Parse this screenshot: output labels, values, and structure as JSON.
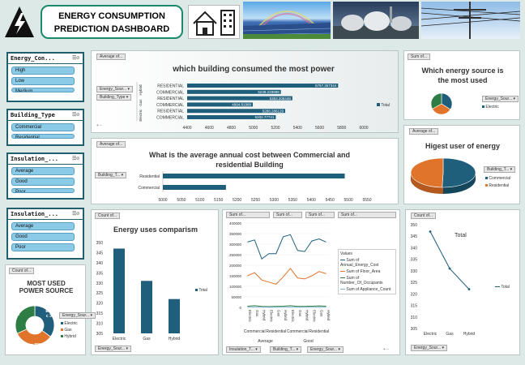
{
  "header": {
    "title_line1": "ENERGY CONSUMPTION",
    "title_line2": "PREDICTION DASHBOARD"
  },
  "slicers": [
    {
      "title": "Energy_Con...",
      "items": [
        "High",
        "Low",
        "Medium"
      ]
    },
    {
      "title": "Building_Type",
      "items": [
        "Commercial",
        "Residential"
      ]
    },
    {
      "title": "Insulation_...",
      "items": [
        "Average",
        "Good",
        "Poor"
      ]
    },
    {
      "title": "Insulation_...",
      "items": [
        "Average",
        "Good",
        "Poor"
      ]
    }
  ],
  "building_chart": {
    "field_btn": "Average of...",
    "title": "which building consumed the most power",
    "filter1": "Energy_Sour...",
    "filter2": "Building_Type",
    "legend": "Total",
    "groups": [
      "Hybrid",
      "Gas",
      "Electric"
    ],
    "bars": [
      {
        "group": "Hybrid",
        "label": "RESIDENTIAL",
        "value": 5767.36,
        "text": "5767.367344"
      },
      {
        "group": "Hybrid",
        "label": "COMMERCIAL",
        "value": 5249.22,
        "text": "5249.229998"
      },
      {
        "group": "Gas",
        "label": "RESIDENTIAL",
        "value": 5353.21,
        "text": "5353.208448"
      },
      {
        "group": "Gas",
        "label": "COMMERCIAL",
        "value": 4994.82,
        "text": "4994.81988"
      },
      {
        "group": "Electric",
        "label": "RESIDENTIAL",
        "value": 5288.29,
        "text": "5288.286129"
      },
      {
        "group": "Electric",
        "label": "COMMERCIAL",
        "value": 5202.78,
        "text": "5202.77741"
      }
    ],
    "ticks": [
      "4400",
      "4600",
      "4800",
      "5000",
      "5200",
      "5400",
      "5600",
      "5800",
      "6000"
    ],
    "xlim": [
      4400,
      6000
    ]
  },
  "cost_chart": {
    "field_btn": "Average of...",
    "title_line1": "What is the average annual cost between Commercial and",
    "title_line2": "residential Building",
    "filter": "Building_T...",
    "bars": [
      {
        "label": "Residential",
        "value": 5490
      },
      {
        "label": "Commercial",
        "value": 5170
      }
    ],
    "ticks": [
      "5000",
      "5050",
      "5100",
      "5150",
      "5200",
      "5250",
      "5300",
      "5350",
      "5400",
      "5450",
      "5500",
      "5550"
    ],
    "xlim": [
      5000,
      5550
    ]
  },
  "source_pie": {
    "field_btn": "Sum of...",
    "title_line1": "Which energy source is",
    "title_line2": "the most used",
    "filter": "Energy_Sour...",
    "legend": "Electric",
    "slices": [
      34,
      33,
      33
    ],
    "colors": [
      "#1f5f7c",
      "#e0742a",
      "#2e7d44"
    ]
  },
  "user_pie": {
    "field_btn": "Average of...",
    "title": "Higest user of energy",
    "filter": "Building_T...",
    "legend": [
      "Commercial",
      "Residential"
    ],
    "slices": [
      50.5,
      49.5
    ],
    "colors": [
      "#1f5f7c",
      "#e0742a"
    ]
  },
  "uses_bar": {
    "field_btn": "Count of...",
    "title": "Energy uses comparism",
    "legend": "Total",
    "filter": "Energy_Sour...",
    "categories": [
      "Electric",
      "Gas",
      "Hybrid"
    ],
    "values": [
      347,
      331,
      322
    ],
    "ticks": [
      "305",
      "310",
      "315",
      "320",
      "325",
      "330",
      "335",
      "340",
      "345",
      "350"
    ],
    "ylim": [
      305,
      350
    ]
  },
  "donut": {
    "field_btn": "Count of...",
    "title_line1": "MOST USED",
    "title_line2": "POWER SOURCE",
    "labels": [
      "Electric 35%",
      "Gas 33%",
      "Hybrid 32%"
    ],
    "text_electric": "Electri c 35%",
    "text_gas": "Gas 33%",
    "text_hybrid": "Hybrid 32%",
    "values": [
      35,
      33,
      32
    ],
    "legend": [
      "Electric",
      "Gas",
      "Hybrid"
    ],
    "colors": [
      "#1f5f7c",
      "#e0742a",
      "#2e7d44"
    ],
    "filter": "Energy_Sour..."
  },
  "line_chart": {
    "btns": [
      "Sum of...",
      "Sum of...",
      "Sum of..."
    ],
    "top_btn": "Sum of...",
    "legend_title": "Values",
    "series": [
      {
        "name": "Sum of Annual_Energy_Cost",
        "color": "#1f5f7c",
        "values": [
          310000,
          320000,
          230000,
          255000,
          255000,
          335000,
          345000,
          270000,
          265000,
          315000,
          325000,
          310000
        ]
      },
      {
        "name": "Sum of Floor_Area",
        "color": "#e0742a",
        "values": [
          150000,
          165000,
          130000,
          120000,
          110000,
          145000,
          185000,
          140000,
          135000,
          150000,
          170000,
          160000
        ]
      },
      {
        "name": "Sum of Number_Of_Occupants",
        "color": "#2e7d44",
        "values": [
          6000,
          8000,
          5000,
          4000,
          5000,
          6000,
          8000,
          5000,
          5000,
          6000,
          7000,
          6000
        ]
      },
      {
        "name": "Sum of Appliance_Count",
        "color": "#7fb3d5",
        "values": [
          1000,
          1000,
          1000,
          1000,
          1000,
          1000,
          1000,
          1000,
          1000,
          1000,
          1000,
          1000
        ]
      }
    ],
    "sources": [
      "Electric",
      "Gas",
      "Hybrid",
      "Electric",
      "Gas",
      "Hybrid",
      "Electric",
      "Gas",
      "Hybrid",
      "Electric",
      "Gas",
      "Hybrid"
    ],
    "buildings": [
      "Commercial",
      "Residential",
      "Commercial",
      "Residential"
    ],
    "insulation": [
      "Average",
      "Good"
    ],
    "ticks": [
      "0",
      "50000",
      "100000",
      "150000",
      "200000",
      "250000",
      "300000",
      "350000",
      "400000"
    ],
    "ylim": [
      0,
      400000
    ],
    "filters": [
      "Insulation_T...",
      "Building_T...",
      "Energy_Sour..."
    ]
  },
  "trend_chart": {
    "field_btn": "Count of...",
    "title": "Total",
    "legend": "Total",
    "filter": "Energy_Sour...",
    "categories": [
      "Electric",
      "Gas",
      "Hybrid"
    ],
    "values": [
      347,
      331,
      322
    ],
    "ticks": [
      "305",
      "310",
      "315",
      "320",
      "325",
      "330",
      "335",
      "340",
      "345",
      "350"
    ],
    "ylim": [
      305,
      350
    ]
  }
}
